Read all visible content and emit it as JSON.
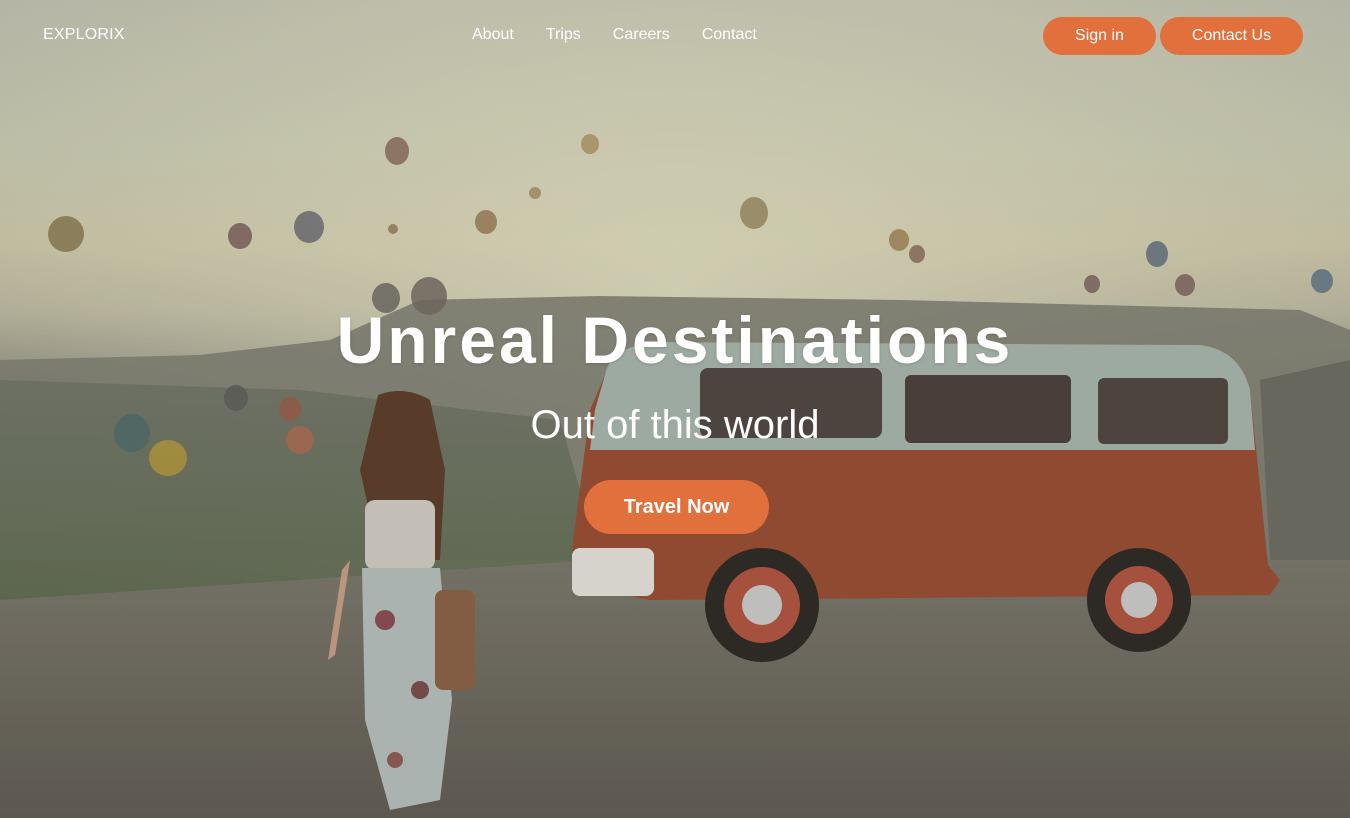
{
  "brand": {
    "name": "EXPLORIX"
  },
  "nav": {
    "links": [
      {
        "label": "About"
      },
      {
        "label": "Trips"
      },
      {
        "label": "Careers"
      },
      {
        "label": "Contact"
      }
    ],
    "sign_in_label": "Sign in",
    "contact_us_label": "Contact Us"
  },
  "hero": {
    "title": "Unreal Destinations",
    "subtitle": "Out of this world",
    "cta_label": "Travel Now",
    "background": "photo of a woman walking toward an orange camper van with hot air balloons over a valley"
  },
  "colors": {
    "accent": "#e2703c",
    "text": "#ffffff"
  }
}
